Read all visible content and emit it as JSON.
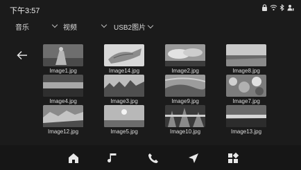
{
  "status": {
    "time": "下午3:57"
  },
  "breadcrumb": [
    {
      "label": "音乐"
    },
    {
      "label": "视频"
    },
    {
      "label": "USB2图片"
    }
  ],
  "images": [
    {
      "name": "Image1.jpg",
      "thumb": "statue"
    },
    {
      "name": "Image14.jpg",
      "thumb": "hand"
    },
    {
      "name": "Image2.jpg",
      "thumb": "clouds"
    },
    {
      "name": "Image8.jpg",
      "thumb": "coast"
    },
    {
      "name": "Image4.jpg",
      "thumb": "dark-stripe"
    },
    {
      "name": "Image3.jpg",
      "thumb": "trees"
    },
    {
      "name": "Image9.jpg",
      "thumb": "sand"
    },
    {
      "name": "Image7.jpg",
      "thumb": "foliage"
    },
    {
      "name": "Image12.jpg",
      "thumb": "rocks"
    },
    {
      "name": "Image5.jpg",
      "thumb": "sun"
    },
    {
      "name": "Image10.jpg",
      "thumb": "forest"
    },
    {
      "name": "Image13.jpg",
      "thumb": "sunset"
    }
  ],
  "dock": [
    {
      "icon": "home-icon"
    },
    {
      "icon": "music-icon"
    },
    {
      "icon": "phone-icon"
    },
    {
      "icon": "navigation-icon"
    },
    {
      "icon": "apps-icon"
    }
  ]
}
